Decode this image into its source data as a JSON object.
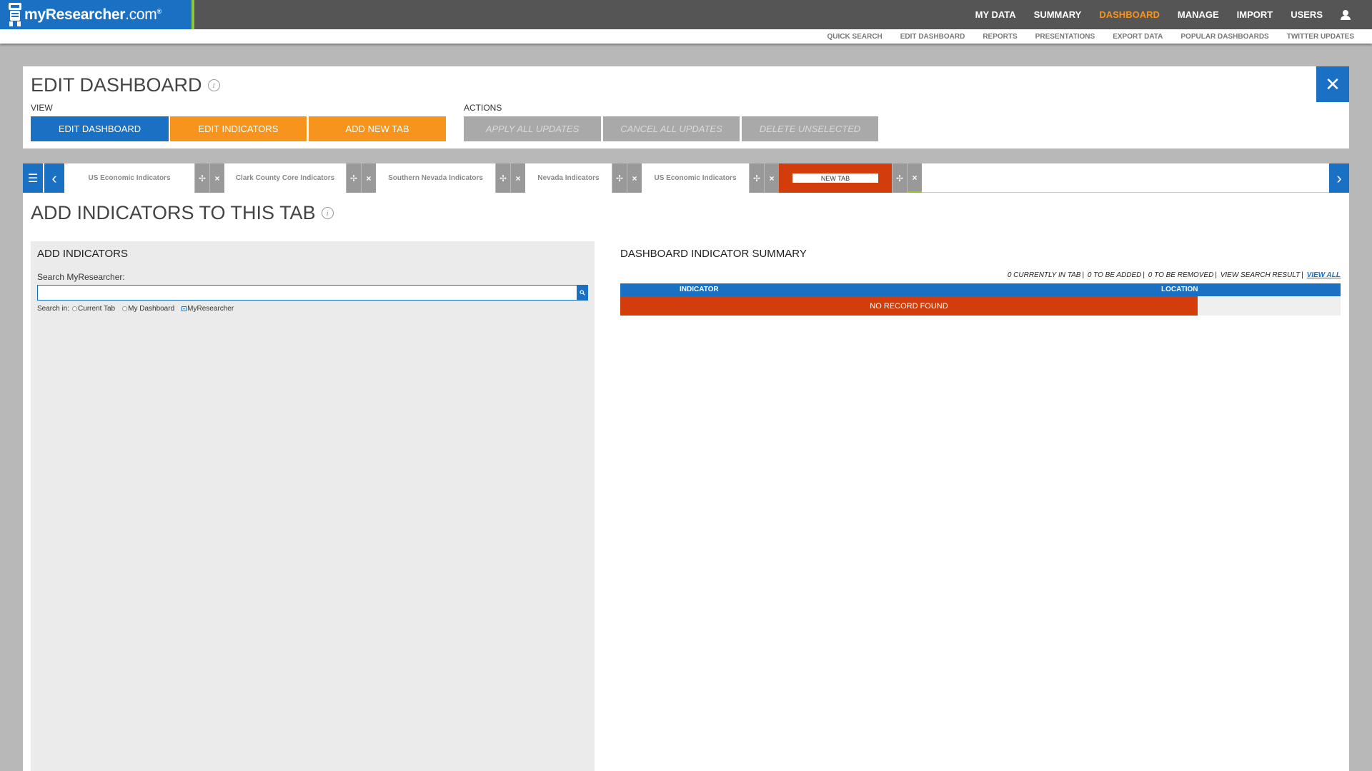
{
  "brand": {
    "name_bold": "myResearcher",
    "name_suffix": ".com",
    "registered": "®"
  },
  "main_nav": {
    "items": [
      "MY DATA",
      "SUMMARY",
      "DASHBOARD",
      "MANAGE",
      "IMPORT",
      "USERS"
    ],
    "active": "DASHBOARD"
  },
  "sub_nav": {
    "items": [
      "QUICK SEARCH",
      "EDIT DASHBOARD",
      "REPORTS",
      "PRESENTATIONS",
      "EXPORT DATA",
      "POPULAR DASHBOARDS",
      "TWITTER UPDATES"
    ]
  },
  "edit_panel": {
    "title": "EDIT DASHBOARD",
    "info_glyph": "i",
    "close_glyph": "✕",
    "view_label": "VIEW",
    "view_buttons": [
      "EDIT DASHBOARD",
      "EDIT INDICATORS",
      "ADD NEW TAB"
    ],
    "actions_label": "ACTIONS",
    "action_buttons": [
      "APPLY ALL UPDATES",
      "CANCEL ALL UPDATES",
      "DELETE UNSELECTED"
    ]
  },
  "tabs": {
    "menu_glyph": "☰",
    "prev_glyph": "‹",
    "next_glyph": "›",
    "move_glyph": "✢",
    "remove_glyph": "×",
    "items": [
      {
        "label": "US Economic Indicators"
      },
      {
        "label": "Clark County Core Indicators"
      },
      {
        "label": "Southern Nevada Indicators"
      },
      {
        "label": "Nevada Indicators"
      },
      {
        "label": "US Economic Indicators"
      },
      {
        "label": "NEW TAB",
        "active": true
      }
    ]
  },
  "add_section": {
    "title": "ADD INDICATORS TO THIS TAB",
    "left": {
      "heading": "ADD INDICATORS",
      "search_label": "Search MyResearcher:",
      "search_value": "",
      "search_in_label": "Search in:",
      "options": [
        "Current Tab",
        "My Dashboard",
        "MyResearcher"
      ],
      "selected_option": "MyResearcher"
    },
    "right": {
      "heading": "DASHBOARD INDICATOR SUMMARY",
      "summary": {
        "in_tab": "0 CURRENTLY IN TAB",
        "to_add": "0 TO BE ADDED",
        "to_remove": "0 TO BE REMOVED",
        "view_search": "VIEW SEARCH RESULT",
        "view_all": "VIEW ALL"
      },
      "columns": [
        "INDICATOR",
        "LOCATION"
      ],
      "empty_message": "NO RECORD FOUND"
    }
  },
  "colors": {
    "brand_blue": "#1a70c2",
    "accent_orange": "#f7941d",
    "alert_red": "#d33d0b",
    "nav_grey": "#555555"
  }
}
